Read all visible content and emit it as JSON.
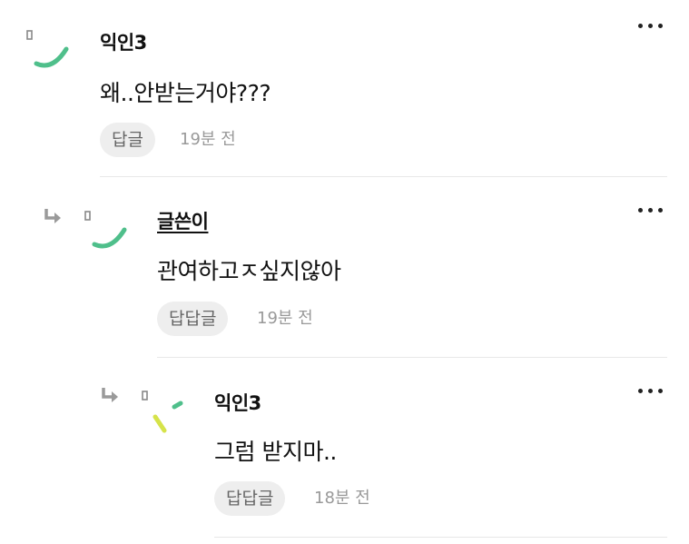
{
  "comments": [
    {
      "author": "익인3",
      "text": "왜..안받는거야???",
      "reply_label": "답글",
      "time": "19분 전",
      "avatar_icon": "green-arc-avatar-icon",
      "menu_icon": "more-options-icon"
    },
    {
      "author": "글쓴이",
      "text": "관여하고ㅈ싶지않아",
      "reply_label": "답답글",
      "time": "19분 전",
      "avatar_icon": "green-arc-avatar-icon",
      "reply_icon": "reply-arrow-icon",
      "menu_icon": "more-options-icon"
    },
    {
      "author": "익인3",
      "text": "그럼 받지마..",
      "reply_label": "답답글",
      "time": "18분 전",
      "avatar_icon": "yellow-green-dash-avatar-icon",
      "reply_icon": "reply-arrow-icon",
      "menu_icon": "more-options-icon"
    }
  ],
  "colors": {
    "avatar_green": "#4fbf8b",
    "avatar_yellow": "#d6e34a",
    "reply_button_bg": "#eeeeee",
    "time_text": "#999999"
  }
}
